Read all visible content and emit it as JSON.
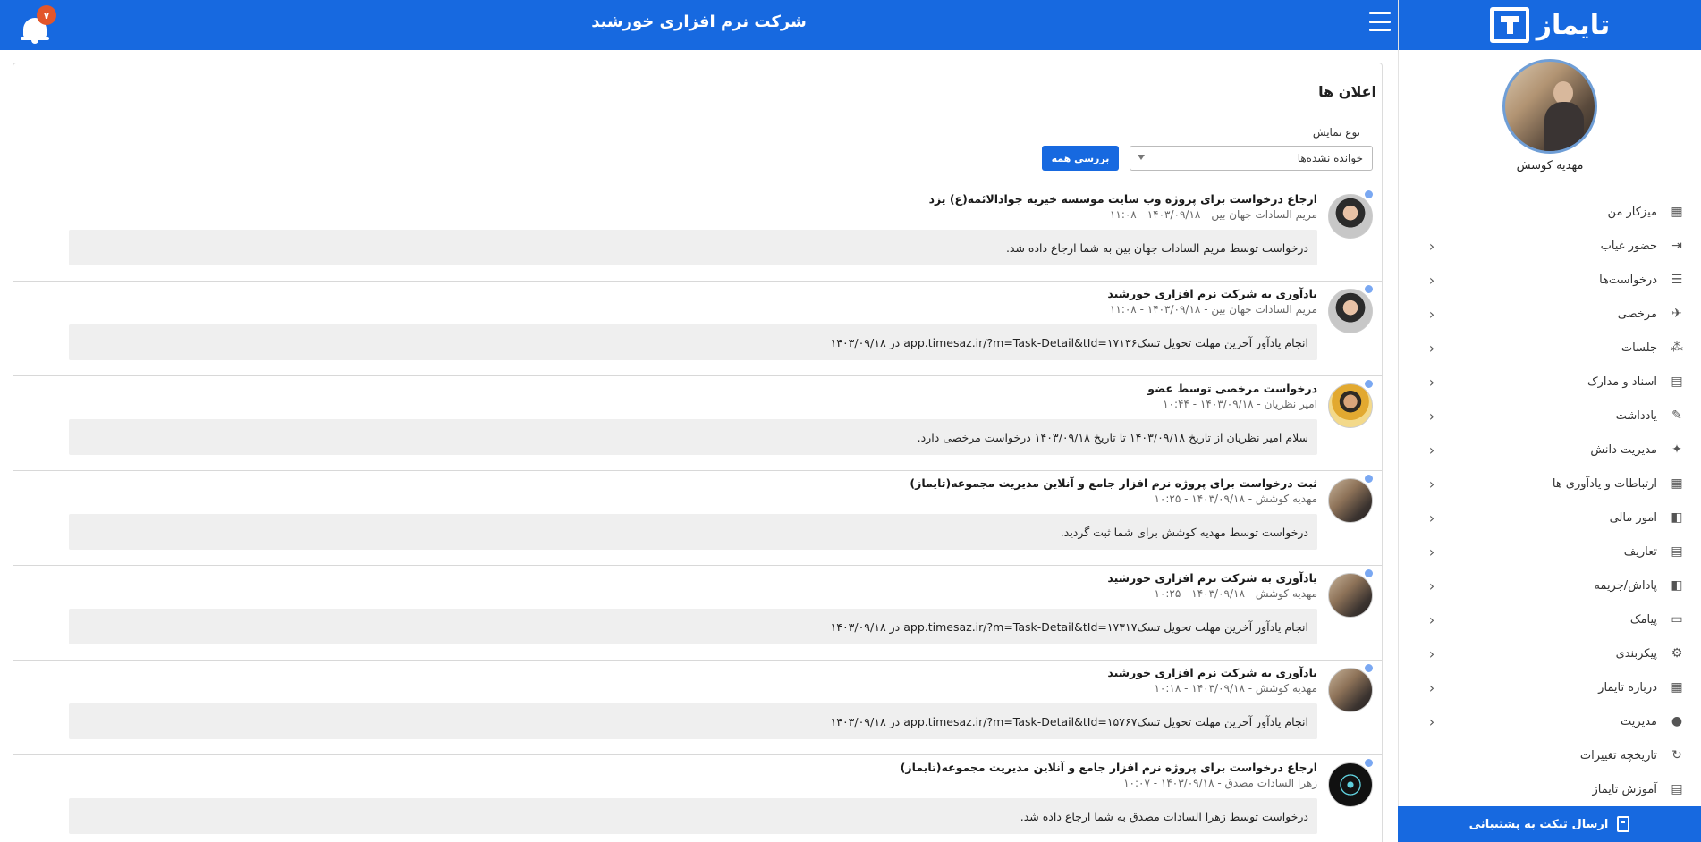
{
  "header": {
    "company_title": "شرکت نرم افزاری خورشید",
    "notification_count": "۷"
  },
  "sidebar": {
    "logo_text": "تایماز",
    "user_name": "مهدیه کوشش",
    "items": [
      {
        "label": "میزکار من",
        "icon": "dashboard-icon",
        "has_arrow": false
      },
      {
        "label": "حضور غیاب",
        "icon": "attendance-icon",
        "has_arrow": true
      },
      {
        "label": "درخواست‌ها",
        "icon": "requests-icon",
        "has_arrow": true
      },
      {
        "label": "مرخصی",
        "icon": "leave-icon",
        "has_arrow": true
      },
      {
        "label": "جلسات",
        "icon": "meetings-icon",
        "has_arrow": true
      },
      {
        "label": "اسناد و مدارک",
        "icon": "documents-icon",
        "has_arrow": true
      },
      {
        "label": "یادداشت",
        "icon": "pencil-icon",
        "has_arrow": true
      },
      {
        "label": "مدیریت دانش",
        "icon": "knowledge-icon",
        "has_arrow": true
      },
      {
        "label": "ارتباطات و یادآوری ها",
        "icon": "communications-icon",
        "has_arrow": true
      },
      {
        "label": "امور مالی",
        "icon": "finance-icon",
        "has_arrow": true
      },
      {
        "label": "تعاریف",
        "icon": "definitions-icon",
        "has_arrow": true
      },
      {
        "label": "پاداش/جریمه",
        "icon": "reward-icon",
        "has_arrow": true
      },
      {
        "label": "پیامک",
        "icon": "sms-icon",
        "has_arrow": true
      },
      {
        "label": "پیکربندی",
        "icon": "config-icon",
        "has_arrow": true
      },
      {
        "label": "درباره تایماز",
        "icon": "about-icon",
        "has_arrow": true
      },
      {
        "label": "مدیریت",
        "icon": "management-icon",
        "has_arrow": true
      },
      {
        "label": "تاریخچه تغییرات",
        "icon": "history-icon",
        "has_arrow": false
      },
      {
        "label": "آموزش تایماز",
        "icon": "training-icon",
        "has_arrow": false
      }
    ],
    "support_button": "ارسال تیکت به پشتیبانی"
  },
  "main": {
    "title": "اعلان ها",
    "filter_label": "نوع نمایش",
    "filter_value": "خوانده نشده‌ها",
    "review_all_button": "بررسی همه",
    "notifications": [
      {
        "title": "ارجاع درخواست برای پروژه وب سایت موسسه خیریه جوادالائمه(ع) یزد",
        "meta": "مریم السادات جهان بین - ۱۴۰۳/۰۹/۱۸ - ۱۱:۰۸",
        "body": "درخواست توسط مریم السادات جهان بین به شما ارجاع داده شد.",
        "avatar": "av-a"
      },
      {
        "title": "یادآوری به شرکت نرم افزاری خورشید",
        "meta": "مریم السادات جهان بین - ۱۴۰۳/۰۹/۱۸ - ۱۱:۰۸",
        "body": "انجام یادآور آخرین مهلت تحویل تسکapp.timesaz.ir/?m=Task-Detail&tId=۱۷۱۳۶ در ۱۴۰۳/۰۹/۱۸",
        "avatar": "av-a"
      },
      {
        "title": "درخواست مرخصی توسط عضو",
        "meta": "امیر نظریان - ۱۴۰۳/۰۹/۱۸ - ۱۰:۴۴",
        "body": "سلام امیر نظریان از تاریخ ۱۴۰۳/۰۹/۱۸ تا تاریخ ۱۴۰۳/۰۹/۱۸ درخواست مرخصی دارد.",
        "avatar": "av-b"
      },
      {
        "title": "ثبت درخواست برای پروژه نرم افزار جامع و آنلاین مدیریت مجموعه(تایماز)",
        "meta": "مهدیه کوشش - ۱۴۰۳/۰۹/۱۸ - ۱۰:۲۵",
        "body": "درخواست توسط مهدیه کوشش برای شما ثبت گردید.",
        "avatar": "av-c"
      },
      {
        "title": "یادآوری به شرکت نرم افزاری خورشید",
        "meta": "مهدیه کوشش - ۱۴۰۳/۰۹/۱۸ - ۱۰:۲۵",
        "body": "انجام یادآور آخرین مهلت تحویل تسکapp.timesaz.ir/?m=Task-Detail&tId=۱۷۳۱۷ در ۱۴۰۳/۰۹/۱۸",
        "avatar": "av-c"
      },
      {
        "title": "یادآوری به شرکت نرم افزاری خورشید",
        "meta": "مهدیه کوشش - ۱۴۰۳/۰۹/۱۸ - ۱۰:۱۸",
        "body": "انجام یادآور آخرین مهلت تحویل تسکapp.timesaz.ir/?m=Task-Detail&tId=۱۵۷۶۷ در ۱۴۰۳/۰۹/۱۸",
        "avatar": "av-c"
      },
      {
        "title": "ارجاع درخواست برای پروژه نرم افزار جامع و آنلاین مدیریت مجموعه(تایماز)",
        "meta": "زهرا السادات مصدق - ۱۴۰۳/۰۹/۱۸ - ۱۰:۰۷",
        "body": "درخواست توسط زهرا السادات مصدق به شما ارجاع داده شد.",
        "avatar": "av-d"
      }
    ]
  },
  "colors": {
    "primary": "#1769e0",
    "badge": "#e2562b",
    "unread_dot": "#7aa8f2",
    "body_bg": "#efefef"
  }
}
